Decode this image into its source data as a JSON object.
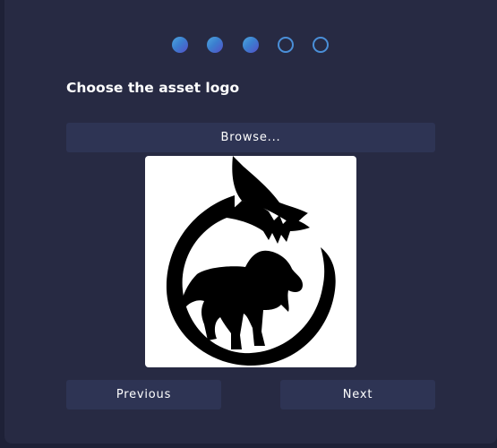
{
  "wizard": {
    "steps": [
      {
        "state": "done"
      },
      {
        "state": "done"
      },
      {
        "state": "done"
      },
      {
        "state": "pending"
      },
      {
        "state": "pending"
      }
    ],
    "title": "Choose the asset logo",
    "browse_label": "Browse...",
    "previous_label": "Previous",
    "next_label": "Next"
  },
  "colors": {
    "background": "#272a43",
    "button": "#2e3454",
    "accent": "#4a8fd8"
  },
  "logo": {
    "icon": "shark-dog-moon-logo-icon"
  }
}
